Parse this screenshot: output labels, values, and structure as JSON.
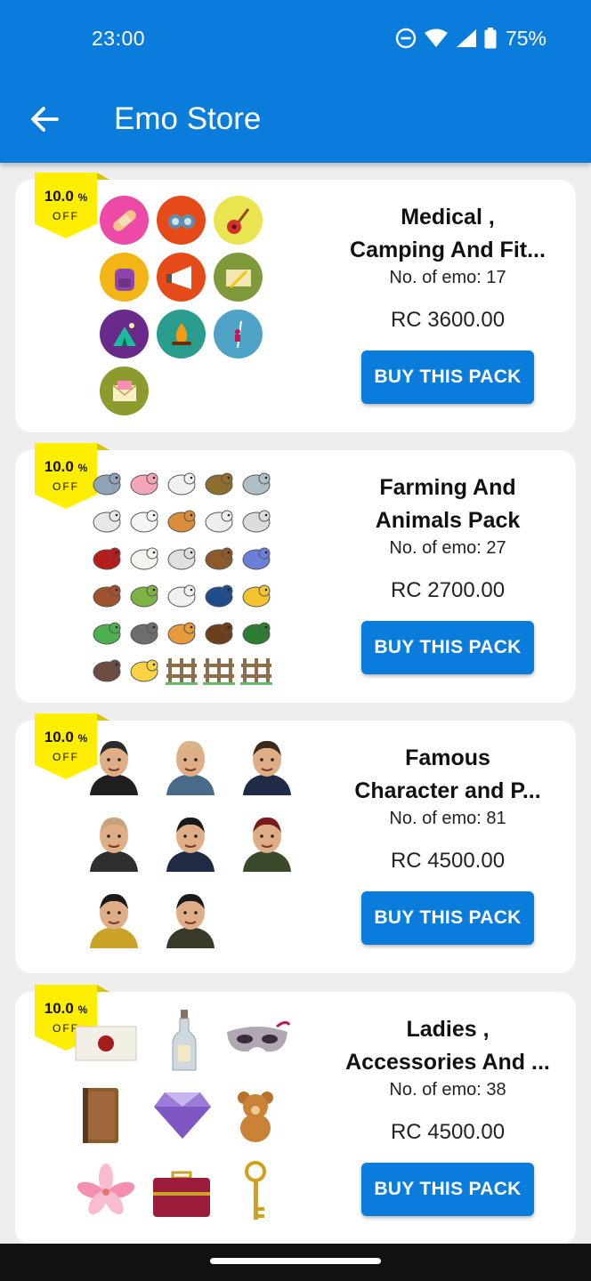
{
  "status_bar": {
    "time": "23:00",
    "battery": "75%"
  },
  "app_bar": {
    "title": "Emo Store"
  },
  "icons": [
    "back-arrow-icon",
    "do-not-disturb-icon",
    "wifi-icon",
    "signal-icon",
    "battery-icon"
  ],
  "packs": [
    {
      "discount_value": "10.0",
      "discount_unit": "%",
      "discount_label": "OFF",
      "title_line1": "Medical ,",
      "title_line2": "Camping And Fit...",
      "count": "No. of emo: 17",
      "price": "RC 3600.00",
      "button": "BUY THIS PACK",
      "emoji_icons": [
        "bandage-icon",
        "binoculars-icon",
        "guitar-icon",
        "backpack-icon",
        "megaphone-icon",
        "letter-pencil-icon",
        "tent-icon",
        "campfire-icon",
        "climbing-icon",
        "envelope-icon"
      ]
    },
    {
      "discount_value": "10.0",
      "discount_unit": "%",
      "discount_label": "OFF",
      "title_line1": "Farming And",
      "title_line2": "Animals Pack",
      "count": "No. of emo: 27",
      "price": "RC 2700.00",
      "button": "BUY THIS PACK",
      "emoji_icons": [
        "donkey-icon",
        "pig-icon",
        "goose-icon",
        "duck-icon",
        "elephant-icon",
        "sheep-icon",
        "hen-icon",
        "hay-bale-icon",
        "ram-icon",
        "goat-icon",
        "barn-icon",
        "eggs-icon",
        "cow-icon",
        "bull-icon",
        "cup-icon",
        "rooster-icon",
        "farmer-icon",
        "dairy-cow-icon",
        "truck-icon",
        "chick-icon",
        "tree-icon",
        "dog-icon",
        "cat-icon",
        "horse-icon",
        "tractor-icon",
        "rifle-icon",
        "duckling-icon",
        "fence-icon",
        "fence-icon",
        "fence-icon"
      ]
    },
    {
      "discount_value": "10.0",
      "discount_unit": "%",
      "discount_label": "OFF",
      "title_line1": "Famous",
      "title_line2": "Character and P...",
      "count": "No. of emo: 81",
      "price": "RC 4500.00",
      "button": "BUY THIS PACK",
      "emoji_icons": [
        "bearded-cleric-avatar-icon",
        "bald-man-avatar-icon",
        "president-sash-avatar-icon",
        "blond-man-avatar-icon",
        "smiling-man-avatar-icon",
        "red-beret-avatar-icon",
        "headband-man-avatar-icon",
        "sunglasses-man-avatar-icon"
      ]
    },
    {
      "discount_value": "10.0",
      "discount_unit": "%",
      "discount_label": "OFF",
      "title_line1": "Ladies ,",
      "title_line2": "Accessories And ...",
      "count": "No. of emo: 38",
      "price": "RC 4500.00",
      "button": "BUY THIS PACK",
      "emoji_icons": [
        "sealed-letter-icon",
        "message-bottle-icon",
        "masquerade-mask-icon",
        "book-icon",
        "diamond-icon",
        "teddy-bear-icon",
        "lily-flower-icon",
        "jewelry-box-icon",
        "golden-key-icon"
      ]
    }
  ]
}
